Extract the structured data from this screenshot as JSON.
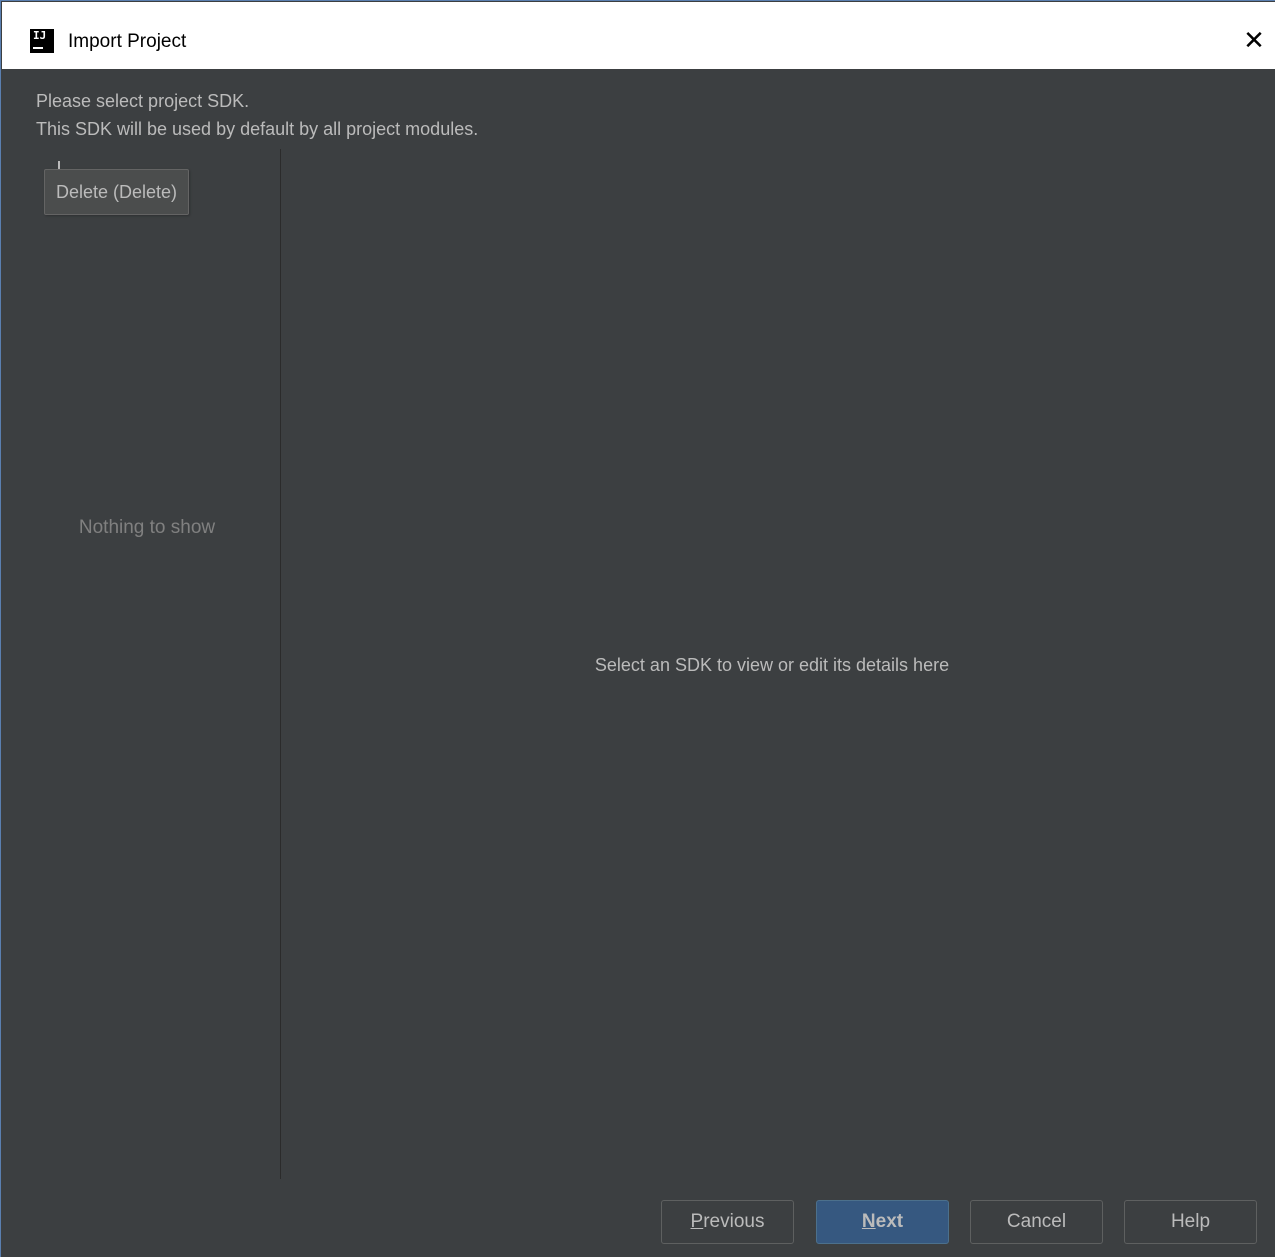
{
  "window": {
    "title": "Import Project",
    "app_icon_text": "IJ",
    "close_glyph": "✕"
  },
  "description": {
    "line1": "Please select project SDK.",
    "line2": "This SDK will be used by default by all project modules."
  },
  "sdk_list": {
    "empty_text": "Nothing to show",
    "tooltip": "Delete (Delete)"
  },
  "details": {
    "empty_text": "Select an SDK to view or edit its details here"
  },
  "buttons": {
    "previous": {
      "mnemonic": "P",
      "rest": "revious"
    },
    "next": {
      "mnemonic": "N",
      "rest": "ext"
    },
    "cancel": "Cancel",
    "help": "Help"
  },
  "colors": {
    "background": "#3c3f41",
    "titlebar": "#ffffff",
    "default_button": "#365880",
    "text": "#bbbbbb",
    "muted_text": "#808080"
  }
}
